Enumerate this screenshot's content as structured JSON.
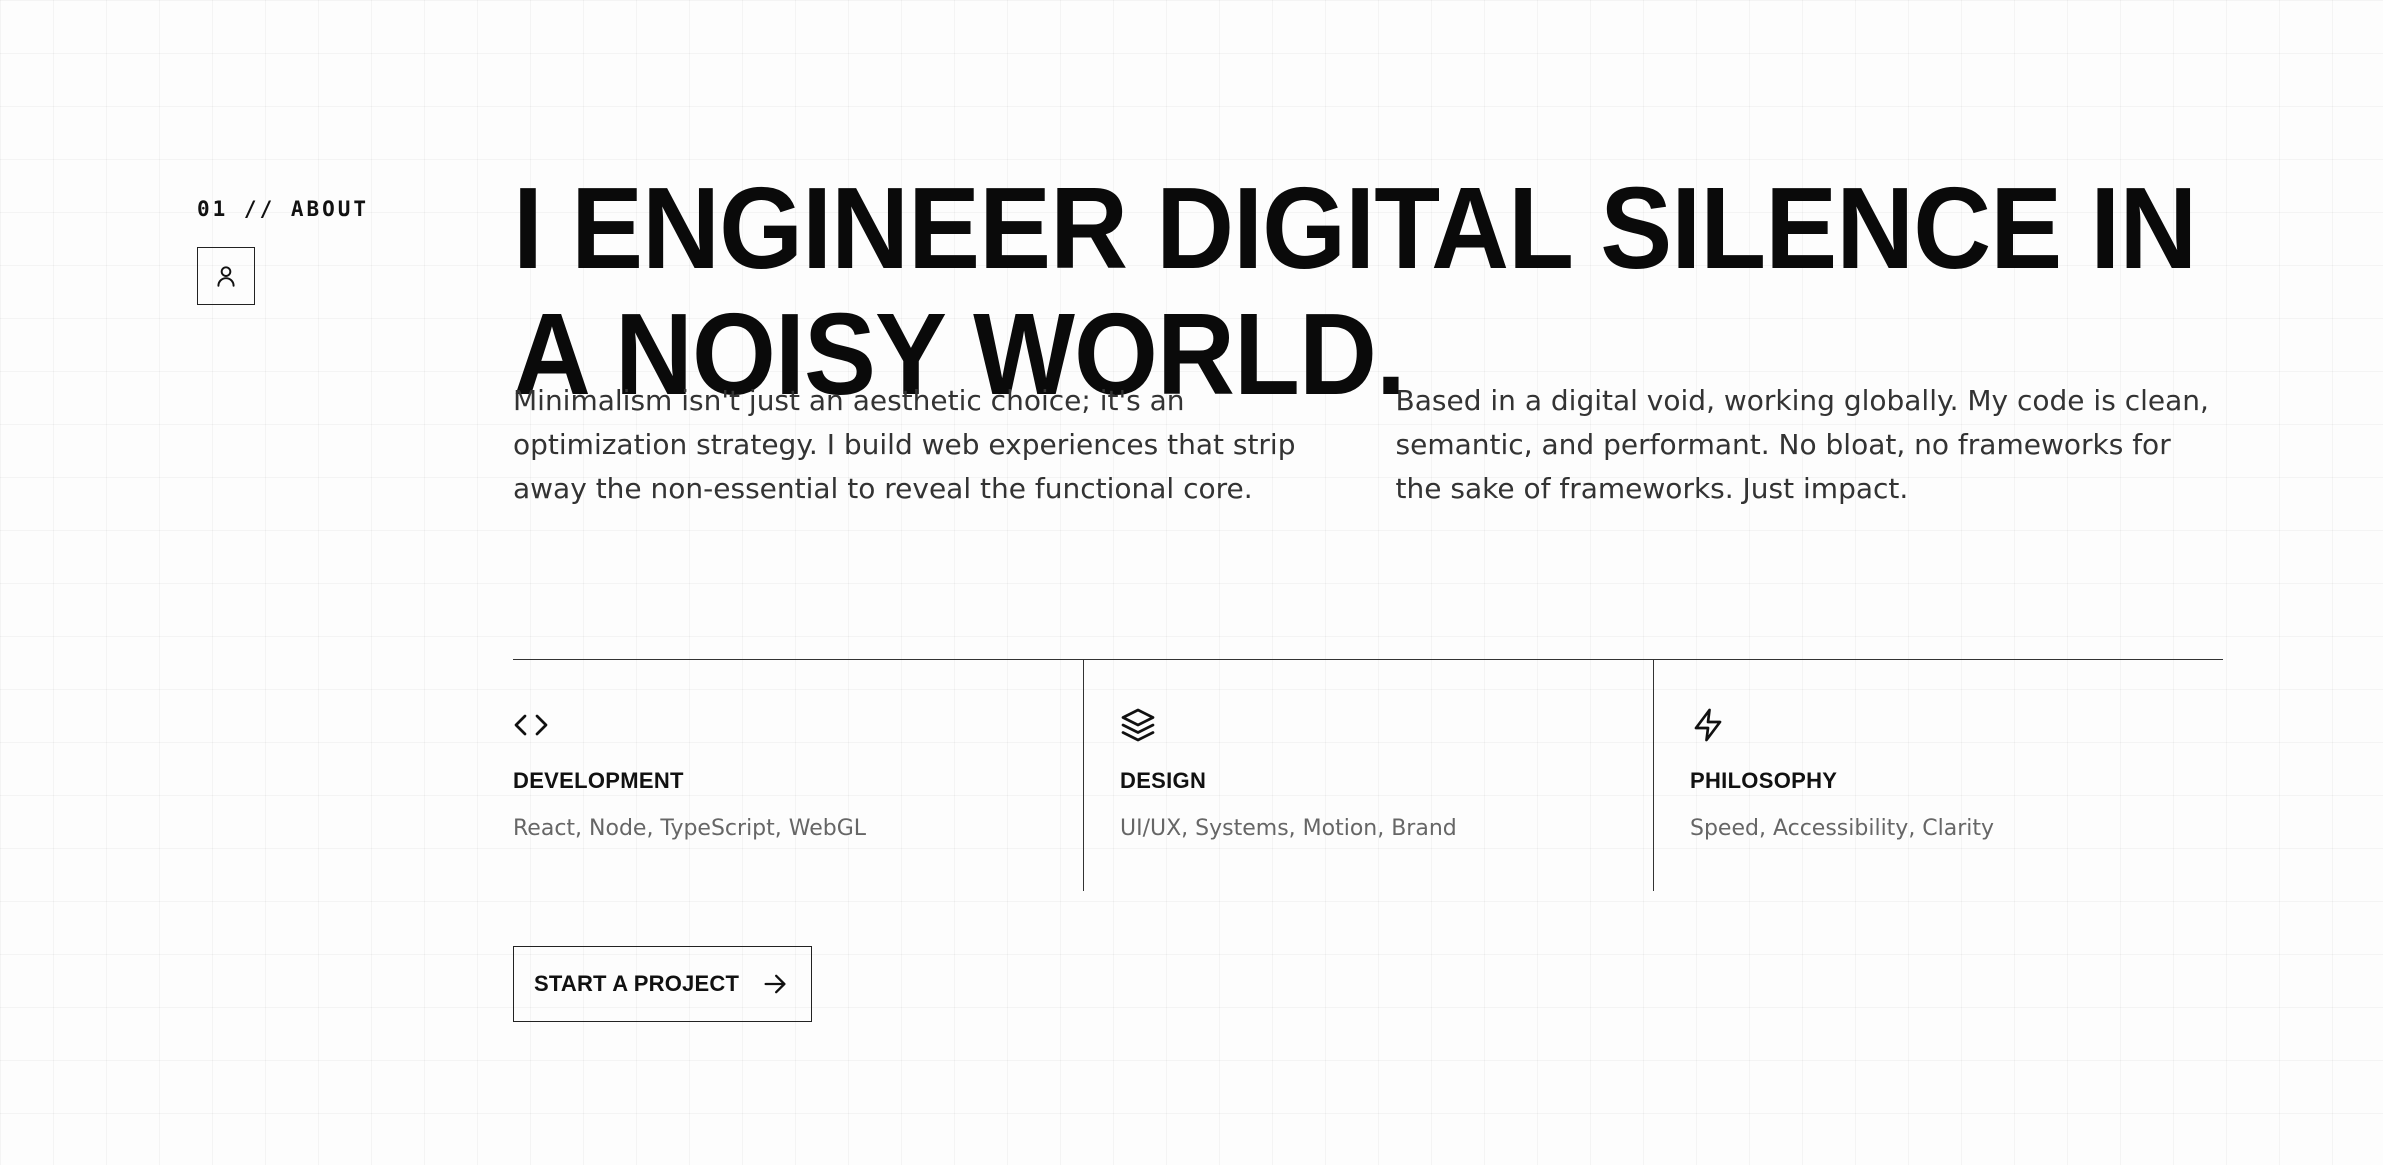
{
  "about": {
    "section_label": "01 // ABOUT",
    "headline": "I ENGINEER DIGITAL SILENCE IN A NOISY WORLD.",
    "intro_left": "Minimalism isn't just an aesthetic choice; it's an optimization strategy. I build web experiences that strip away the non-essential to reveal the functional core.",
    "intro_right": "Based in a digital void, working globally. My code is clean, semantic, and performant. No bloat, no frameworks for the sake of frameworks. Just impact."
  },
  "skills": [
    {
      "icon": "code-icon",
      "title": "DEVELOPMENT",
      "description": "React, Node, TypeScript, WebGL"
    },
    {
      "icon": "layers-icon",
      "title": "DESIGN",
      "description": "UI/UX, Systems, Motion, Brand"
    },
    {
      "icon": "lightning-icon",
      "title": "PHILOSOPHY",
      "description": "Speed, Accessibility, Clarity"
    }
  ],
  "cta": {
    "label": "START A PROJECT",
    "icon": "arrow-right-icon"
  }
}
